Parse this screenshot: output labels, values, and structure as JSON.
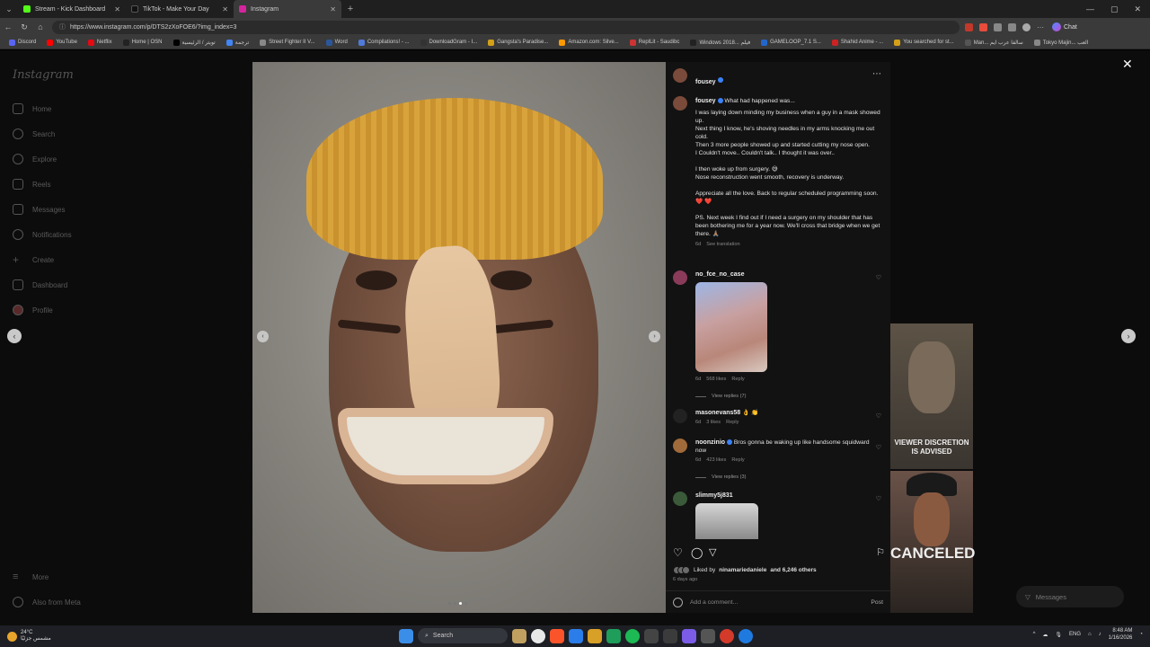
{
  "browser": {
    "tabs": [
      {
        "label": "Stream - Kick Dashboard",
        "color": "#53fc18",
        "active": false
      },
      {
        "label": "TikTok - Make Your Day",
        "color": "#111111",
        "active": false
      },
      {
        "label": "Instagram",
        "color": "#d6249f",
        "active": true
      }
    ],
    "url": "https://www.instagram.com/p/DTS2zXoFOE6/?img_index=3",
    "chat_label": "Chat",
    "bookmarks": [
      {
        "label": "Discord",
        "color": "#5865f2"
      },
      {
        "label": "YouTube",
        "color": "#ff0000"
      },
      {
        "label": "Netflix",
        "color": "#e50914"
      },
      {
        "label": "Home | OSN",
        "color": "#222222"
      },
      {
        "label": "تويتر / الرئيسية",
        "color": "#000000"
      },
      {
        "label": "ترجمة",
        "color": "#4285f4"
      },
      {
        "label": "Street Fighter II V...",
        "color": "#888888"
      },
      {
        "label": "Word",
        "color": "#2b579a"
      },
      {
        "label": "Compilations! - ...",
        "color": "#4f7ad8"
      },
      {
        "label": "DownloadGram - I...",
        "color": "#333333"
      },
      {
        "label": "Gangsta's Paradise...",
        "color": "#d4a017"
      },
      {
        "label": "Amazon.com: Silve...",
        "color": "#ff9900"
      },
      {
        "label": "ReplLit - Saudibc",
        "color": "#cc3333"
      },
      {
        "label": "Windows 2018... فيلم",
        "color": "#222222"
      },
      {
        "label": "GAMELOOP_7.1 S...",
        "color": "#2266cc"
      },
      {
        "label": "Shahid Anime - ...",
        "color": "#cc2222"
      },
      {
        "label": "You searched for st...",
        "color": "#d4a017"
      },
      {
        "label": "Man... سالفا عرب ايم",
        "color": "#555555"
      },
      {
        "label": "Tokyo Majin... العب",
        "color": "#888888"
      }
    ]
  },
  "sidebar": {
    "logo": "Instagram",
    "items": [
      {
        "label": "Home"
      },
      {
        "label": "Search"
      },
      {
        "label": "Explore"
      },
      {
        "label": "Reels"
      },
      {
        "label": "Messages"
      },
      {
        "label": "Notifications"
      },
      {
        "label": "Create"
      },
      {
        "label": "Dashboard"
      },
      {
        "label": "Profile"
      }
    ],
    "more": "More",
    "meta": "Also from Meta"
  },
  "post": {
    "author": "fousey",
    "options_icon": "more-horizontal-icon",
    "caption_intro": "What had happened was...",
    "caption_paragraphs": [
      "I was laying down minding my business when a guy in a mask showed up.\nNext thing I know, he's shoving needles in my arms knocking me out cold.\nThen 3 more people showed up and started cutting my nose open.\nI Couldn't move.. Couldn't talk.. I thought it was over..",
      "I then woke up from surgery. 😅\nNose reconstruction went smooth, recovery is underway.",
      "Appreciate all the love. Back to regular scheduled programming soon. ❤️ ❤️",
      "PS. Next week I find out if I need a surgery on my shoulder that has been bothering me for a year now. We'll cross that bridge when we get there. 🙏🏽"
    ],
    "caption_age": "6d",
    "see_translation": "See translation",
    "comments": [
      {
        "user": "no_fce_no_case",
        "text": "",
        "age": "6d",
        "likes": "568 likes",
        "reply": "Reply",
        "view_replies": "View replies (7)"
      },
      {
        "user": "masonevans58",
        "text": "👌 👏",
        "age": "6d",
        "likes": "3 likes",
        "reply": "Reply",
        "view_replies": ""
      },
      {
        "user": "noonzinio",
        "text": "Bros gonna be waking up like handsome squidward now",
        "age": "6d",
        "likes": "423 likes",
        "reply": "Reply",
        "view_replies": "View replies (3)"
      },
      {
        "user": "slimmy5j831",
        "text": "",
        "age": "",
        "likes": "",
        "reply": "",
        "view_replies": ""
      }
    ],
    "liked_by_prefix": "Liked by",
    "liked_by_user": "ninamariedaniele",
    "liked_by_suffix": "and 6,246 others",
    "date": "6 days ago",
    "add_comment_placeholder": "Add a comment...",
    "post_button": "Post"
  },
  "side_cards": [
    {
      "overlay_text": "VIEWER DISCRETION IS ADVISED"
    },
    {
      "overlay_text": "CANCELED"
    }
  ],
  "messages_pill": "Messages",
  "taskbar": {
    "temp": "24°C",
    "weather_desc": "مشمس جزئيًا",
    "search_label": "Search",
    "lang": "ENG",
    "time": "8:48 AM",
    "date": "1/16/2026"
  }
}
